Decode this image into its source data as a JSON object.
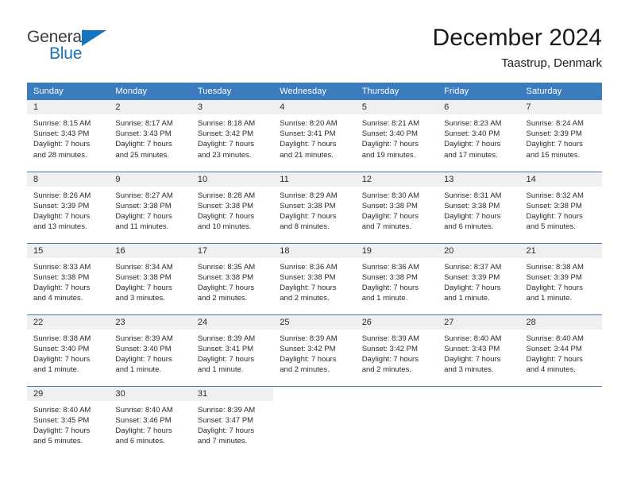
{
  "brand": {
    "name_top": "General",
    "name_bottom": "Blue",
    "accent_color": "#1673bd",
    "triangle_icon": "brand-triangle-icon"
  },
  "header": {
    "title": "December 2024",
    "subtitle": "Taastrup, Denmark"
  },
  "theme": {
    "header_bg": "#3a7cbe",
    "band_bg": "#efefef",
    "text": "#2b2b2b"
  },
  "weekday_headers": [
    "Sunday",
    "Monday",
    "Tuesday",
    "Wednesday",
    "Thursday",
    "Friday",
    "Saturday"
  ],
  "weeks": [
    [
      {
        "day": "1",
        "sunrise": "Sunrise: 8:15 AM",
        "sunset": "Sunset: 3:43 PM",
        "daylight_l1": "Daylight: 7 hours",
        "daylight_l2": "and 28 minutes."
      },
      {
        "day": "2",
        "sunrise": "Sunrise: 8:17 AM",
        "sunset": "Sunset: 3:43 PM",
        "daylight_l1": "Daylight: 7 hours",
        "daylight_l2": "and 25 minutes."
      },
      {
        "day": "3",
        "sunrise": "Sunrise: 8:18 AM",
        "sunset": "Sunset: 3:42 PM",
        "daylight_l1": "Daylight: 7 hours",
        "daylight_l2": "and 23 minutes."
      },
      {
        "day": "4",
        "sunrise": "Sunrise: 8:20 AM",
        "sunset": "Sunset: 3:41 PM",
        "daylight_l1": "Daylight: 7 hours",
        "daylight_l2": "and 21 minutes."
      },
      {
        "day": "5",
        "sunrise": "Sunrise: 8:21 AM",
        "sunset": "Sunset: 3:40 PM",
        "daylight_l1": "Daylight: 7 hours",
        "daylight_l2": "and 19 minutes."
      },
      {
        "day": "6",
        "sunrise": "Sunrise: 8:23 AM",
        "sunset": "Sunset: 3:40 PM",
        "daylight_l1": "Daylight: 7 hours",
        "daylight_l2": "and 17 minutes."
      },
      {
        "day": "7",
        "sunrise": "Sunrise: 8:24 AM",
        "sunset": "Sunset: 3:39 PM",
        "daylight_l1": "Daylight: 7 hours",
        "daylight_l2": "and 15 minutes."
      }
    ],
    [
      {
        "day": "8",
        "sunrise": "Sunrise: 8:26 AM",
        "sunset": "Sunset: 3:39 PM",
        "daylight_l1": "Daylight: 7 hours",
        "daylight_l2": "and 13 minutes."
      },
      {
        "day": "9",
        "sunrise": "Sunrise: 8:27 AM",
        "sunset": "Sunset: 3:38 PM",
        "daylight_l1": "Daylight: 7 hours",
        "daylight_l2": "and 11 minutes."
      },
      {
        "day": "10",
        "sunrise": "Sunrise: 8:28 AM",
        "sunset": "Sunset: 3:38 PM",
        "daylight_l1": "Daylight: 7 hours",
        "daylight_l2": "and 10 minutes."
      },
      {
        "day": "11",
        "sunrise": "Sunrise: 8:29 AM",
        "sunset": "Sunset: 3:38 PM",
        "daylight_l1": "Daylight: 7 hours",
        "daylight_l2": "and 8 minutes."
      },
      {
        "day": "12",
        "sunrise": "Sunrise: 8:30 AM",
        "sunset": "Sunset: 3:38 PM",
        "daylight_l1": "Daylight: 7 hours",
        "daylight_l2": "and 7 minutes."
      },
      {
        "day": "13",
        "sunrise": "Sunrise: 8:31 AM",
        "sunset": "Sunset: 3:38 PM",
        "daylight_l1": "Daylight: 7 hours",
        "daylight_l2": "and 6 minutes."
      },
      {
        "day": "14",
        "sunrise": "Sunrise: 8:32 AM",
        "sunset": "Sunset: 3:38 PM",
        "daylight_l1": "Daylight: 7 hours",
        "daylight_l2": "and 5 minutes."
      }
    ],
    [
      {
        "day": "15",
        "sunrise": "Sunrise: 8:33 AM",
        "sunset": "Sunset: 3:38 PM",
        "daylight_l1": "Daylight: 7 hours",
        "daylight_l2": "and 4 minutes."
      },
      {
        "day": "16",
        "sunrise": "Sunrise: 8:34 AM",
        "sunset": "Sunset: 3:38 PM",
        "daylight_l1": "Daylight: 7 hours",
        "daylight_l2": "and 3 minutes."
      },
      {
        "day": "17",
        "sunrise": "Sunrise: 8:35 AM",
        "sunset": "Sunset: 3:38 PM",
        "daylight_l1": "Daylight: 7 hours",
        "daylight_l2": "and 2 minutes."
      },
      {
        "day": "18",
        "sunrise": "Sunrise: 8:36 AM",
        "sunset": "Sunset: 3:38 PM",
        "daylight_l1": "Daylight: 7 hours",
        "daylight_l2": "and 2 minutes."
      },
      {
        "day": "19",
        "sunrise": "Sunrise: 8:36 AM",
        "sunset": "Sunset: 3:38 PM",
        "daylight_l1": "Daylight: 7 hours",
        "daylight_l2": "and 1 minute."
      },
      {
        "day": "20",
        "sunrise": "Sunrise: 8:37 AM",
        "sunset": "Sunset: 3:39 PM",
        "daylight_l1": "Daylight: 7 hours",
        "daylight_l2": "and 1 minute."
      },
      {
        "day": "21",
        "sunrise": "Sunrise: 8:38 AM",
        "sunset": "Sunset: 3:39 PM",
        "daylight_l1": "Daylight: 7 hours",
        "daylight_l2": "and 1 minute."
      }
    ],
    [
      {
        "day": "22",
        "sunrise": "Sunrise: 8:38 AM",
        "sunset": "Sunset: 3:40 PM",
        "daylight_l1": "Daylight: 7 hours",
        "daylight_l2": "and 1 minute."
      },
      {
        "day": "23",
        "sunrise": "Sunrise: 8:39 AM",
        "sunset": "Sunset: 3:40 PM",
        "daylight_l1": "Daylight: 7 hours",
        "daylight_l2": "and 1 minute."
      },
      {
        "day": "24",
        "sunrise": "Sunrise: 8:39 AM",
        "sunset": "Sunset: 3:41 PM",
        "daylight_l1": "Daylight: 7 hours",
        "daylight_l2": "and 1 minute."
      },
      {
        "day": "25",
        "sunrise": "Sunrise: 8:39 AM",
        "sunset": "Sunset: 3:42 PM",
        "daylight_l1": "Daylight: 7 hours",
        "daylight_l2": "and 2 minutes."
      },
      {
        "day": "26",
        "sunrise": "Sunrise: 8:39 AM",
        "sunset": "Sunset: 3:42 PM",
        "daylight_l1": "Daylight: 7 hours",
        "daylight_l2": "and 2 minutes."
      },
      {
        "day": "27",
        "sunrise": "Sunrise: 8:40 AM",
        "sunset": "Sunset: 3:43 PM",
        "daylight_l1": "Daylight: 7 hours",
        "daylight_l2": "and 3 minutes."
      },
      {
        "day": "28",
        "sunrise": "Sunrise: 8:40 AM",
        "sunset": "Sunset: 3:44 PM",
        "daylight_l1": "Daylight: 7 hours",
        "daylight_l2": "and 4 minutes."
      }
    ],
    [
      {
        "day": "29",
        "sunrise": "Sunrise: 8:40 AM",
        "sunset": "Sunset: 3:45 PM",
        "daylight_l1": "Daylight: 7 hours",
        "daylight_l2": "and 5 minutes."
      },
      {
        "day": "30",
        "sunrise": "Sunrise: 8:40 AM",
        "sunset": "Sunset: 3:46 PM",
        "daylight_l1": "Daylight: 7 hours",
        "daylight_l2": "and 6 minutes."
      },
      {
        "day": "31",
        "sunrise": "Sunrise: 8:39 AM",
        "sunset": "Sunset: 3:47 PM",
        "daylight_l1": "Daylight: 7 hours",
        "daylight_l2": "and 7 minutes."
      },
      {
        "day": "",
        "sunrise": "",
        "sunset": "",
        "daylight_l1": "",
        "daylight_l2": ""
      },
      {
        "day": "",
        "sunrise": "",
        "sunset": "",
        "daylight_l1": "",
        "daylight_l2": ""
      },
      {
        "day": "",
        "sunrise": "",
        "sunset": "",
        "daylight_l1": "",
        "daylight_l2": ""
      },
      {
        "day": "",
        "sunrise": "",
        "sunset": "",
        "daylight_l1": "",
        "daylight_l2": ""
      }
    ]
  ]
}
